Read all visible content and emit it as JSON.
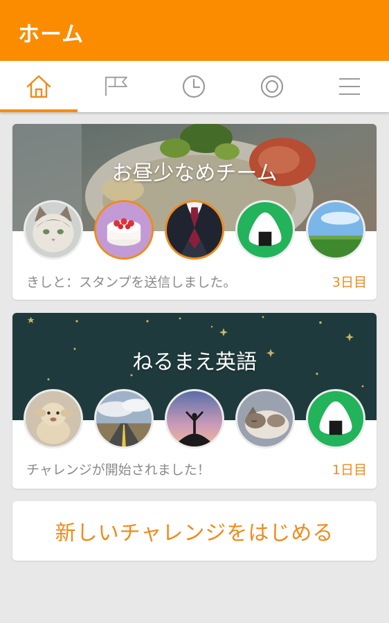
{
  "header": {
    "title": "ホーム"
  },
  "tabs": [
    {
      "name": "home",
      "icon": "home-icon",
      "active": true
    },
    {
      "name": "challenges",
      "icon": "flag-icon",
      "active": false
    },
    {
      "name": "history",
      "icon": "clock-icon",
      "active": false
    },
    {
      "name": "goals",
      "icon": "target-icon",
      "active": false
    },
    {
      "name": "menu",
      "icon": "menu-icon",
      "active": false
    }
  ],
  "teams": [
    {
      "title": "お昼少なめチーム",
      "status": "きしと：スタンプを送信しました。",
      "days": "3日目",
      "members": [
        "cat-avatar",
        "cake-avatar",
        "suit-avatar",
        "onigiri-avatar",
        "field-avatar"
      ]
    },
    {
      "title": "ねるまえ英語",
      "status": "チャレンジが開始されました！",
      "days": "1日目",
      "members": [
        "sheep-avatar",
        "road-avatar",
        "sunset-person-avatar",
        "cat-sleeping-avatar",
        "onigiri-avatar"
      ]
    }
  ],
  "new_challenge": {
    "label": "新しいチャレンジをはじめる"
  },
  "colors": {
    "accent": "#fb8c00",
    "text_accent": "#f08a1a",
    "night_banner": "#1f3a3d"
  }
}
